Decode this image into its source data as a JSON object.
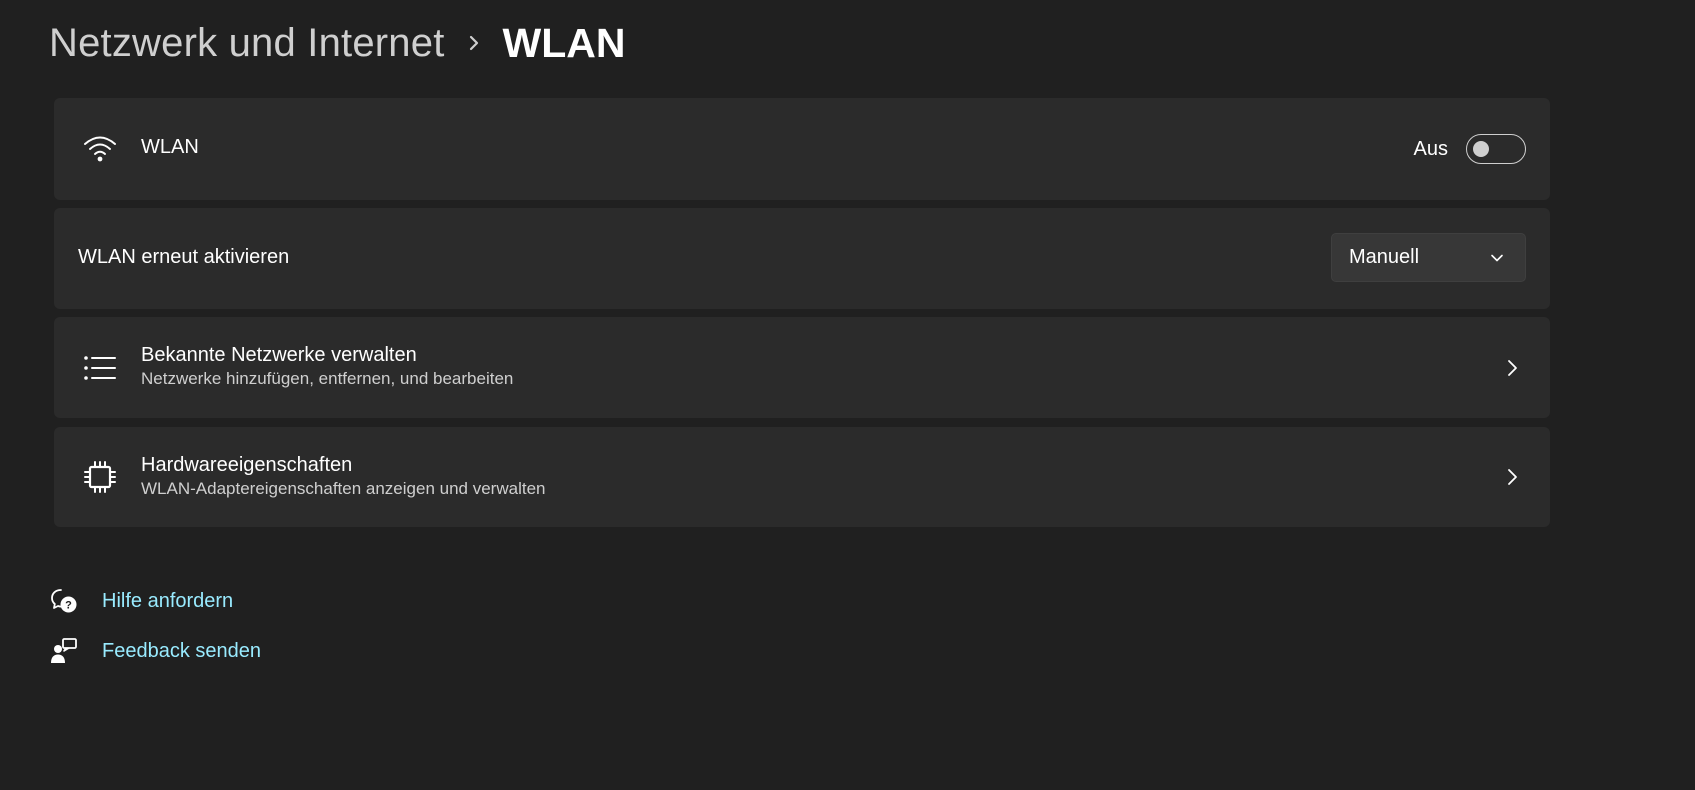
{
  "breadcrumb": {
    "parent": "Netzwerk und Internet",
    "current": "WLAN"
  },
  "wlan_card": {
    "icon": "wifi-icon",
    "title": "WLAN",
    "toggle_label": "Aus",
    "toggle_on": false
  },
  "reenable_card": {
    "title": "WLAN erneut aktivieren",
    "dropdown_value": "Manuell"
  },
  "known_networks_card": {
    "icon": "list-icon",
    "title": "Bekannte Netzwerke verwalten",
    "subtitle": "Netzwerke hinzufügen, entfernen, und bearbeiten"
  },
  "hardware_card": {
    "icon": "chip-icon",
    "title": "Hardwareeigenschaften",
    "subtitle": "WLAN-Adaptereigenschaften anzeigen und verwalten"
  },
  "links": {
    "help": {
      "icon": "help-chat-icon",
      "label": "Hilfe anfordern"
    },
    "feedback": {
      "icon": "feedback-icon",
      "label": "Feedback senden"
    }
  },
  "colors": {
    "background": "#202020",
    "card": "#2b2b2b",
    "link": "#99ebff"
  }
}
